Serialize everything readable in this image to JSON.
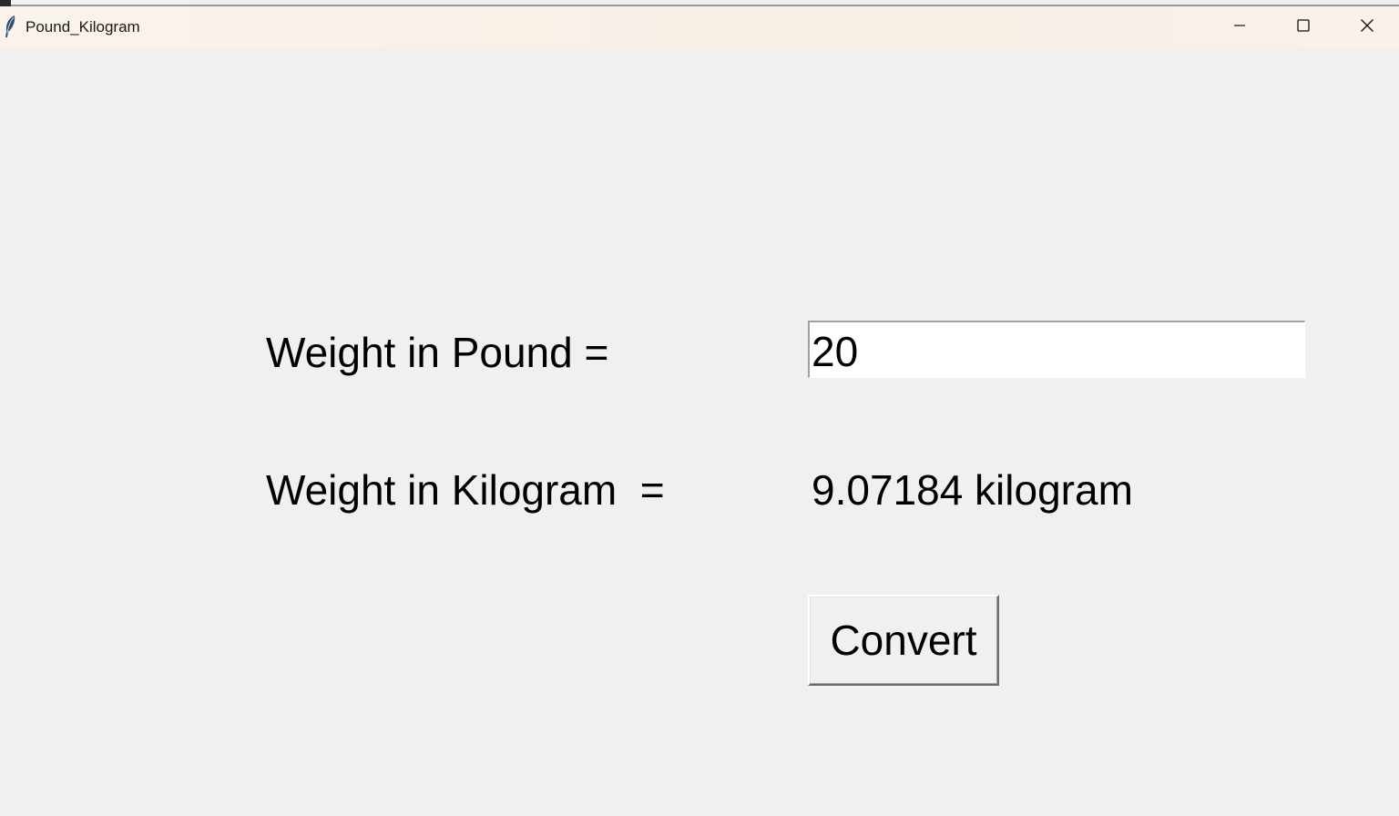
{
  "window": {
    "title": "Pound_Kilogram",
    "icon": "feather-icon",
    "controls": [
      "minimize-icon",
      "maximize-icon",
      "close-icon"
    ]
  },
  "form": {
    "pound_label": "Weight in Pound =",
    "pound_value": "20",
    "kilogram_label": "Weight in Kilogram  =",
    "kilogram_result": "9.07184 kilogram",
    "convert_label": "Convert"
  },
  "colors": {
    "background": "#f0f0f0",
    "titlebar": "#faf3ec",
    "input_background": "#ffffff",
    "text": "#000000"
  }
}
